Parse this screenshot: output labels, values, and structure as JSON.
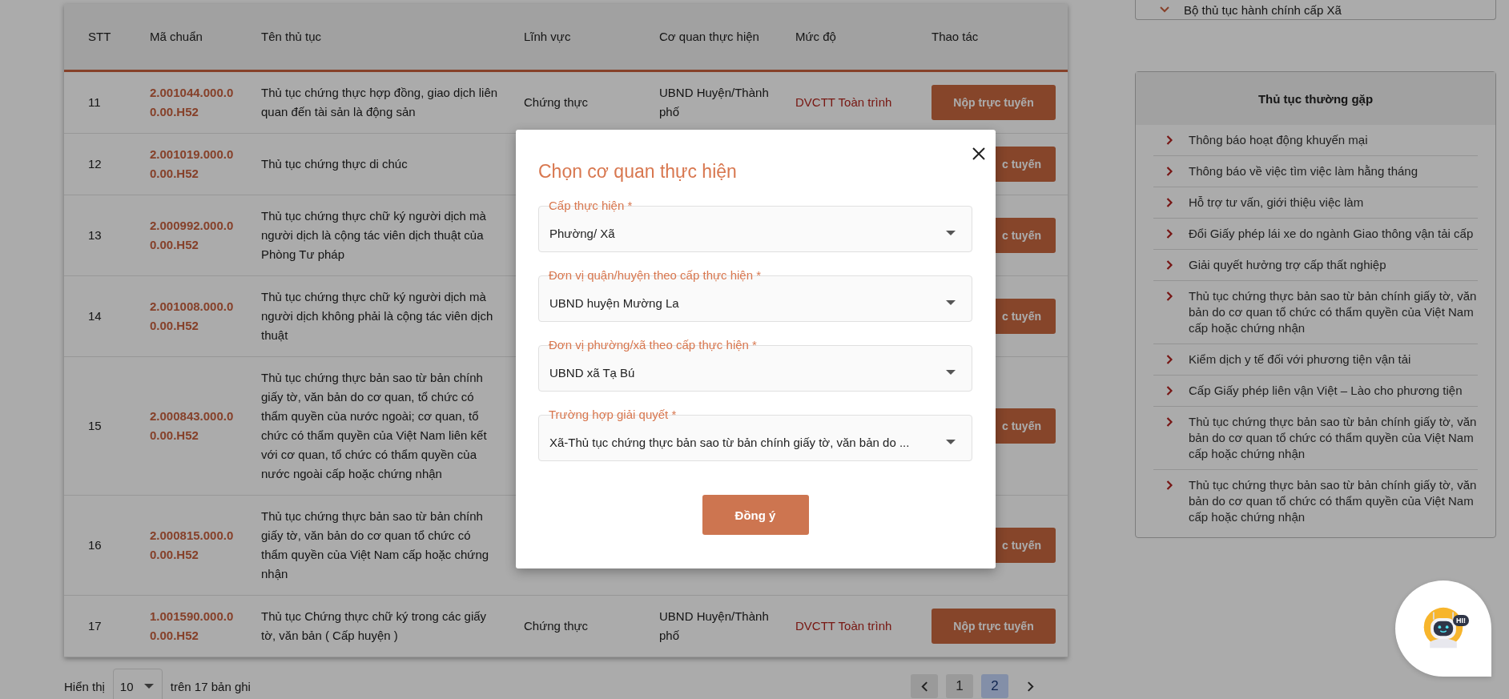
{
  "table": {
    "columns": [
      "STT",
      "Mã chuẩn",
      "Tên thủ tục",
      "Lĩnh vực",
      "Cơ quan thực hiện",
      "Mức độ",
      "Thao tác"
    ],
    "rows": [
      {
        "kind": "full",
        "stt": "11",
        "code": "2.001044.000.00.00.H52",
        "name": "Thủ tục chứng thực hợp đồng, giao dịch liên quan đến tài sản là động sản",
        "field": "Chứng thực",
        "agency": "UBND Huyện/Thành phố",
        "level": "DVCTT Toàn trình",
        "action": "Nộp trực tuyến"
      },
      {
        "kind": "partial",
        "stt": "12",
        "code": "2.001019.000.00.00.H52",
        "name": "Thủ tục chứng thực di chúc",
        "action": "c tuyến"
      },
      {
        "kind": "partial",
        "stt": "13",
        "code": "2.000992.000.00.00.H52",
        "name": "Thủ tục chứng thực chữ ký người dịch mà người dịch là cộng tác viên dịch thuật của Phòng Tư pháp",
        "action": "c tuyến"
      },
      {
        "kind": "partial",
        "stt": "14",
        "code": "2.001008.000.00.00.H52",
        "name": "Thủ tục chứng thực chữ ký người dịch mà người dịch không phải là cộng tác viên dịch thuật",
        "action": "c tuyến"
      },
      {
        "kind": "partial",
        "stt": "15",
        "code": "2.000843.000.00.00.H52",
        "name": "Thủ tục chứng thực bản sao từ bản chính giấy tờ, văn bản do cơ quan, tổ chức có thẩm quyền của nước ngoài; cơ quan, tổ chức có thẩm quyền của Việt Nam liên kết với cơ quan, tổ chức có thẩm quyền của nước ngoài cấp hoặc chứng nhận",
        "action": "c tuyến"
      },
      {
        "kind": "partial",
        "stt": "16",
        "code": "2.000815.000.00.00.H52",
        "name": "Thủ tục chứng thực bản sao từ bản chính giấy tờ, văn bản do cơ quan tổ chức có thẩm quyền của Việt Nam cấp hoặc chứng nhận",
        "action": "c tuyến"
      },
      {
        "kind": "full",
        "stt": "17",
        "code": "1.001590.000.00.00.H52",
        "name": "Thủ tục Chứng thực chữ ký trong các giấy tờ, văn bản ( Cấp huyện )",
        "field": "Chứng thực",
        "agency": "UBND Huyện/Thành phố",
        "level": "DVCTT Toàn trình",
        "action": "Nộp trực tuyến"
      }
    ]
  },
  "pagination": {
    "label_before": "Hiển thị",
    "page_size": "10",
    "label_after": "trên 17 bản ghi",
    "pages": [
      {
        "label": "1",
        "selected": false
      },
      {
        "label": "2",
        "selected": true
      }
    ]
  },
  "sidebar": {
    "collapsed_section": "Bộ thủ tục hành chính cấp Xã",
    "popular": {
      "title": "Thủ tục thường gặp",
      "items": [
        "Thông báo hoạt động khuyến mại",
        "Thông báo về việc tìm việc làm hằng tháng",
        "Hỗ trợ tư vấn, giới thiệu việc làm",
        "Đổi Giấy phép lái xe do ngành Giao thông vận tải cấp",
        "Giải quyết hưởng trợ cấp thất nghiệp",
        "Thủ tục chứng thực bản sao từ bản chính giấy tờ, văn bản do cơ quan tổ chức có thẩm quyền của Việt Nam cấp hoặc chứng nhận",
        "Kiểm dịch y tế đối với phương tiện vận tải",
        "Cấp Giấy phép liên vận Việt – Lào cho phương tiện",
        "Thủ tục chứng thực bản sao từ bản chính giấy tờ, văn bản do cơ quan tổ chức có thẩm quyền của Việt Nam cấp hoặc chứng nhận",
        "Thủ tục chứng thực bản sao từ bản chính giấy tờ, văn bản do cơ quan tổ chức có thẩm quyền của Việt Nam cấp hoặc chứng nhận"
      ]
    }
  },
  "modal": {
    "title": "Chọn cơ quan thực hiện",
    "fields": [
      {
        "label": "Cấp thực hiện *",
        "value": "Phường/ Xã"
      },
      {
        "label": "Đơn vị quận/huyện theo cấp thực hiện *",
        "value": "UBND huyện Mường La"
      },
      {
        "label": "Đơn vị phường/xã theo cấp thực hiện *",
        "value": "UBND xã Tạ Bú"
      },
      {
        "label": "Trường hợp giải quyết *",
        "value": "Xã-Thủ tục chứng thực bản sao từ bản chính giấy tờ, văn bản do ..."
      }
    ],
    "confirm_button": "Đồng ý"
  },
  "chatbot": {
    "badge": "HI!"
  }
}
